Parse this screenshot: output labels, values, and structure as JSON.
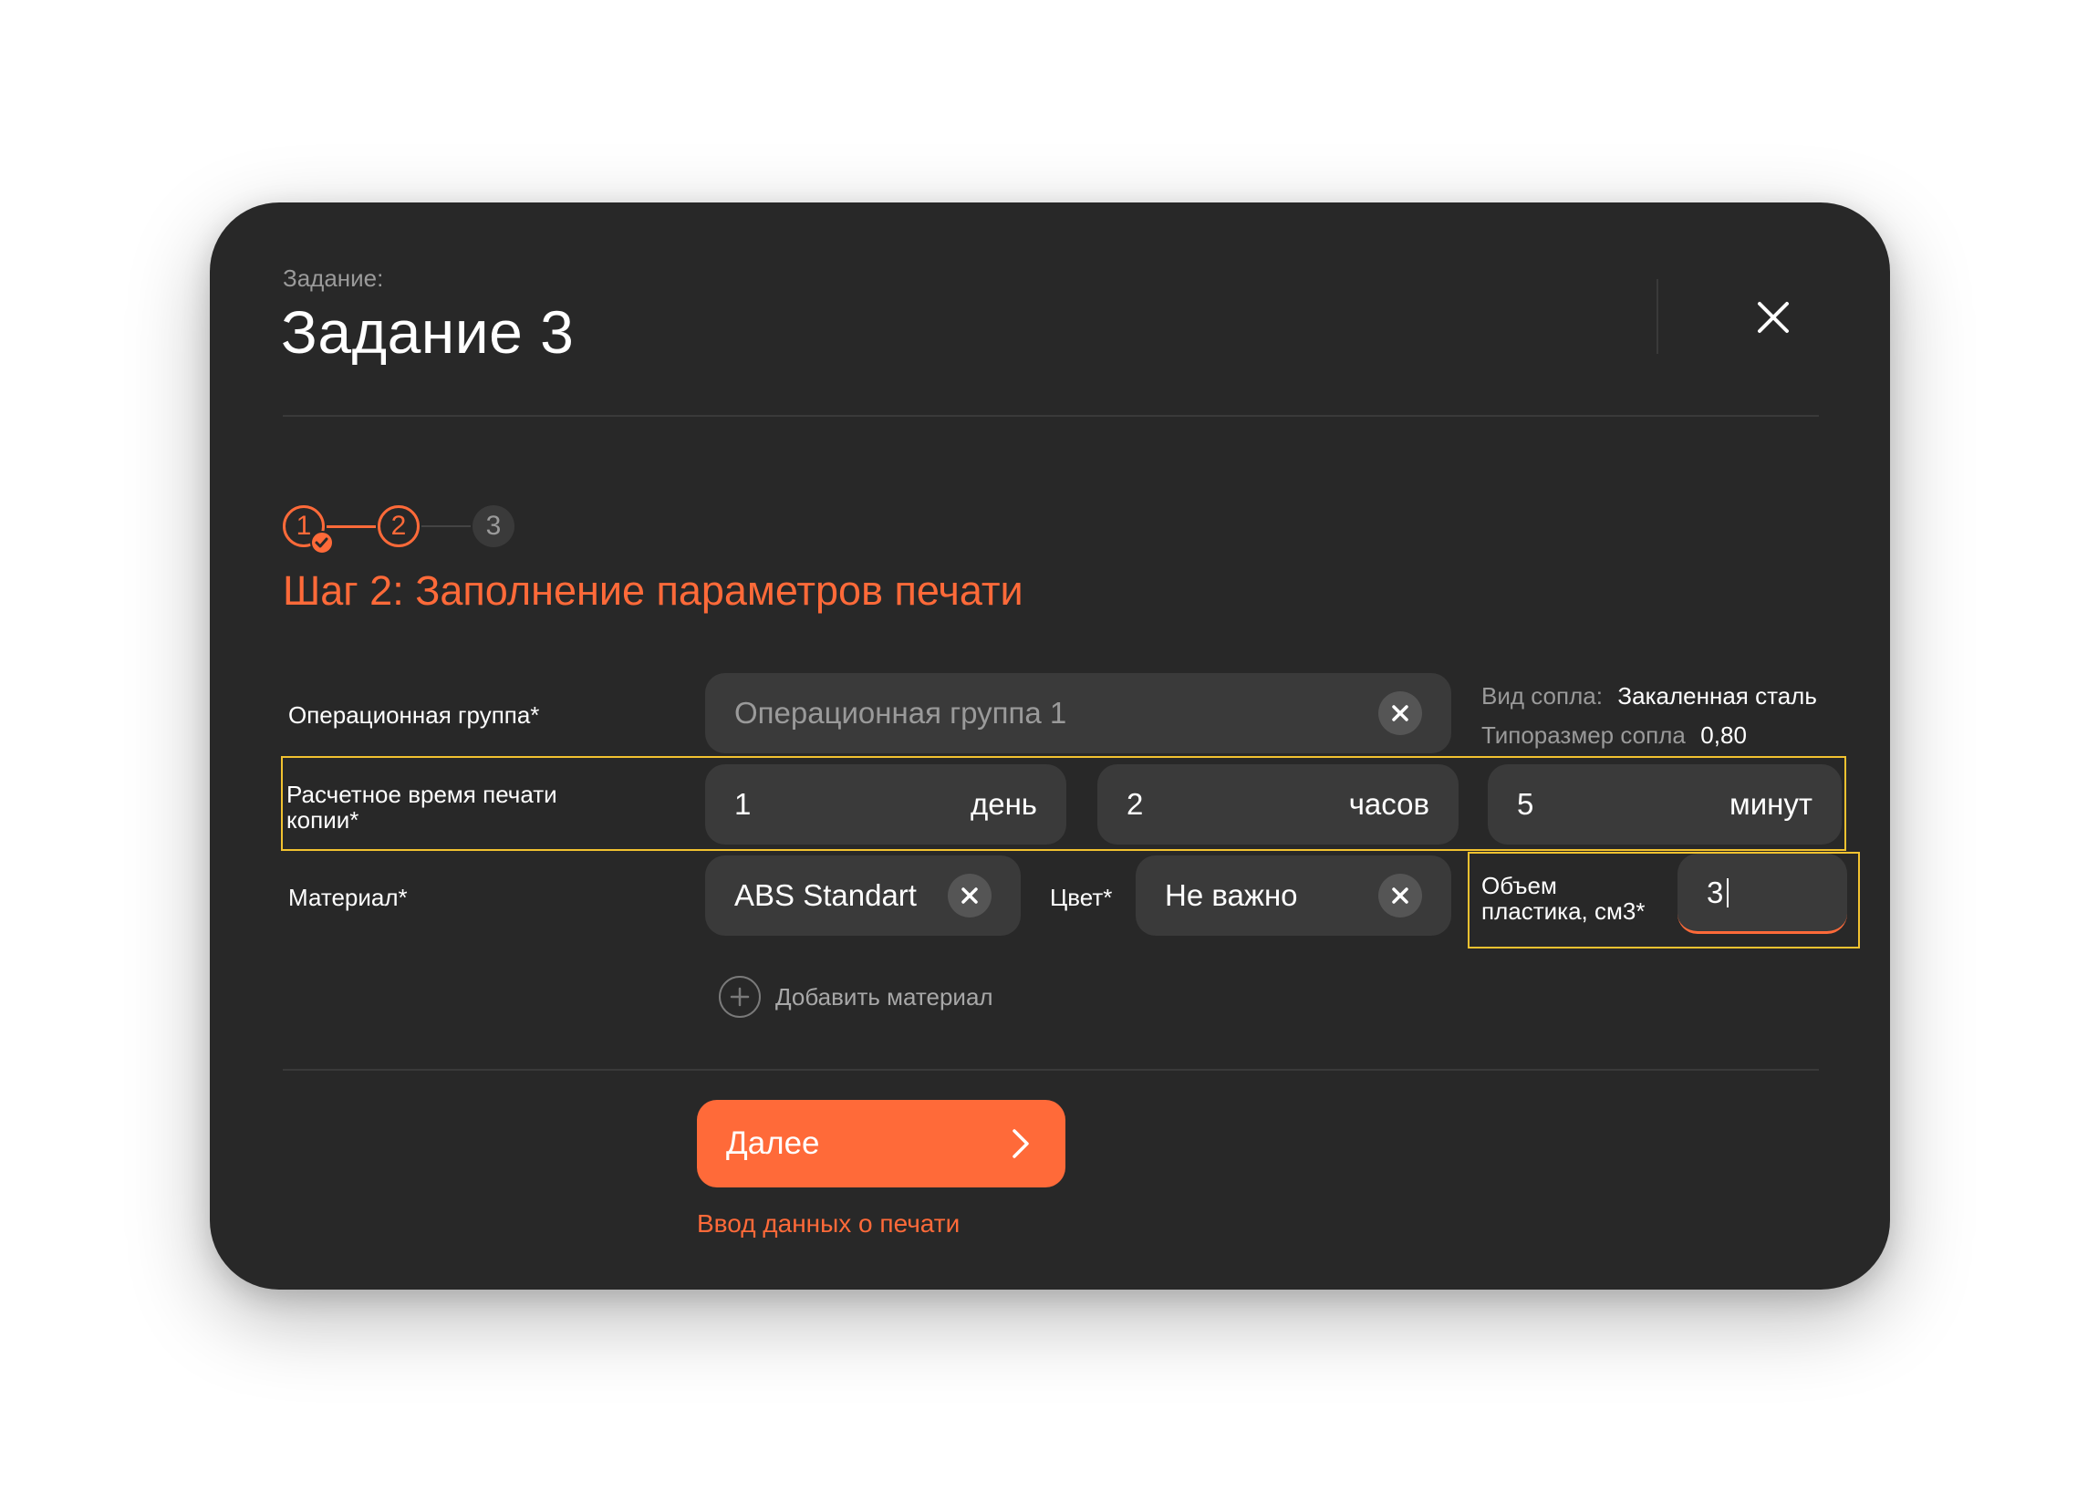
{
  "header": {
    "task_label": "Задание:",
    "task_title": "Задание 3"
  },
  "stepper": {
    "steps": [
      "1",
      "2",
      "3"
    ],
    "completed": 1,
    "current": 2,
    "heading": "Шаг 2: Заполнение параметров печати"
  },
  "form": {
    "op_group": {
      "label": "Операционная группа*",
      "placeholder": "Операционная группа 1"
    },
    "nozzle": {
      "type_key": "Вид сопла:",
      "type_value": "Закаленная сталь",
      "size_key": "Типоразмер сопла",
      "size_value": "0,80"
    },
    "print_time": {
      "label_line1": "Расчетное время печати",
      "label_line2": "копии*",
      "days_value": "1",
      "days_unit": "день",
      "hours_value": "2",
      "hours_unit": "часов",
      "minutes_value": "5",
      "minutes_unit": "минут"
    },
    "material": {
      "label": "Материал*",
      "value": "ABS Standart"
    },
    "color": {
      "label": "Цвет*",
      "value": "Не важно"
    },
    "volume": {
      "label_line1": "Объем",
      "label_line2": "пластика, см3*",
      "value": "3"
    },
    "add_material": "Добавить материал"
  },
  "footer": {
    "next_label": "Далее",
    "sub_link": "Ввод данных о печати"
  },
  "colors": {
    "accent": "#ff6a39",
    "background": "#282828",
    "input": "#3a3a3a",
    "highlight": "#f2c230"
  },
  "icons": [
    "close-icon",
    "check-icon",
    "clear-icon",
    "plus-icon",
    "chevron-right-icon"
  ]
}
